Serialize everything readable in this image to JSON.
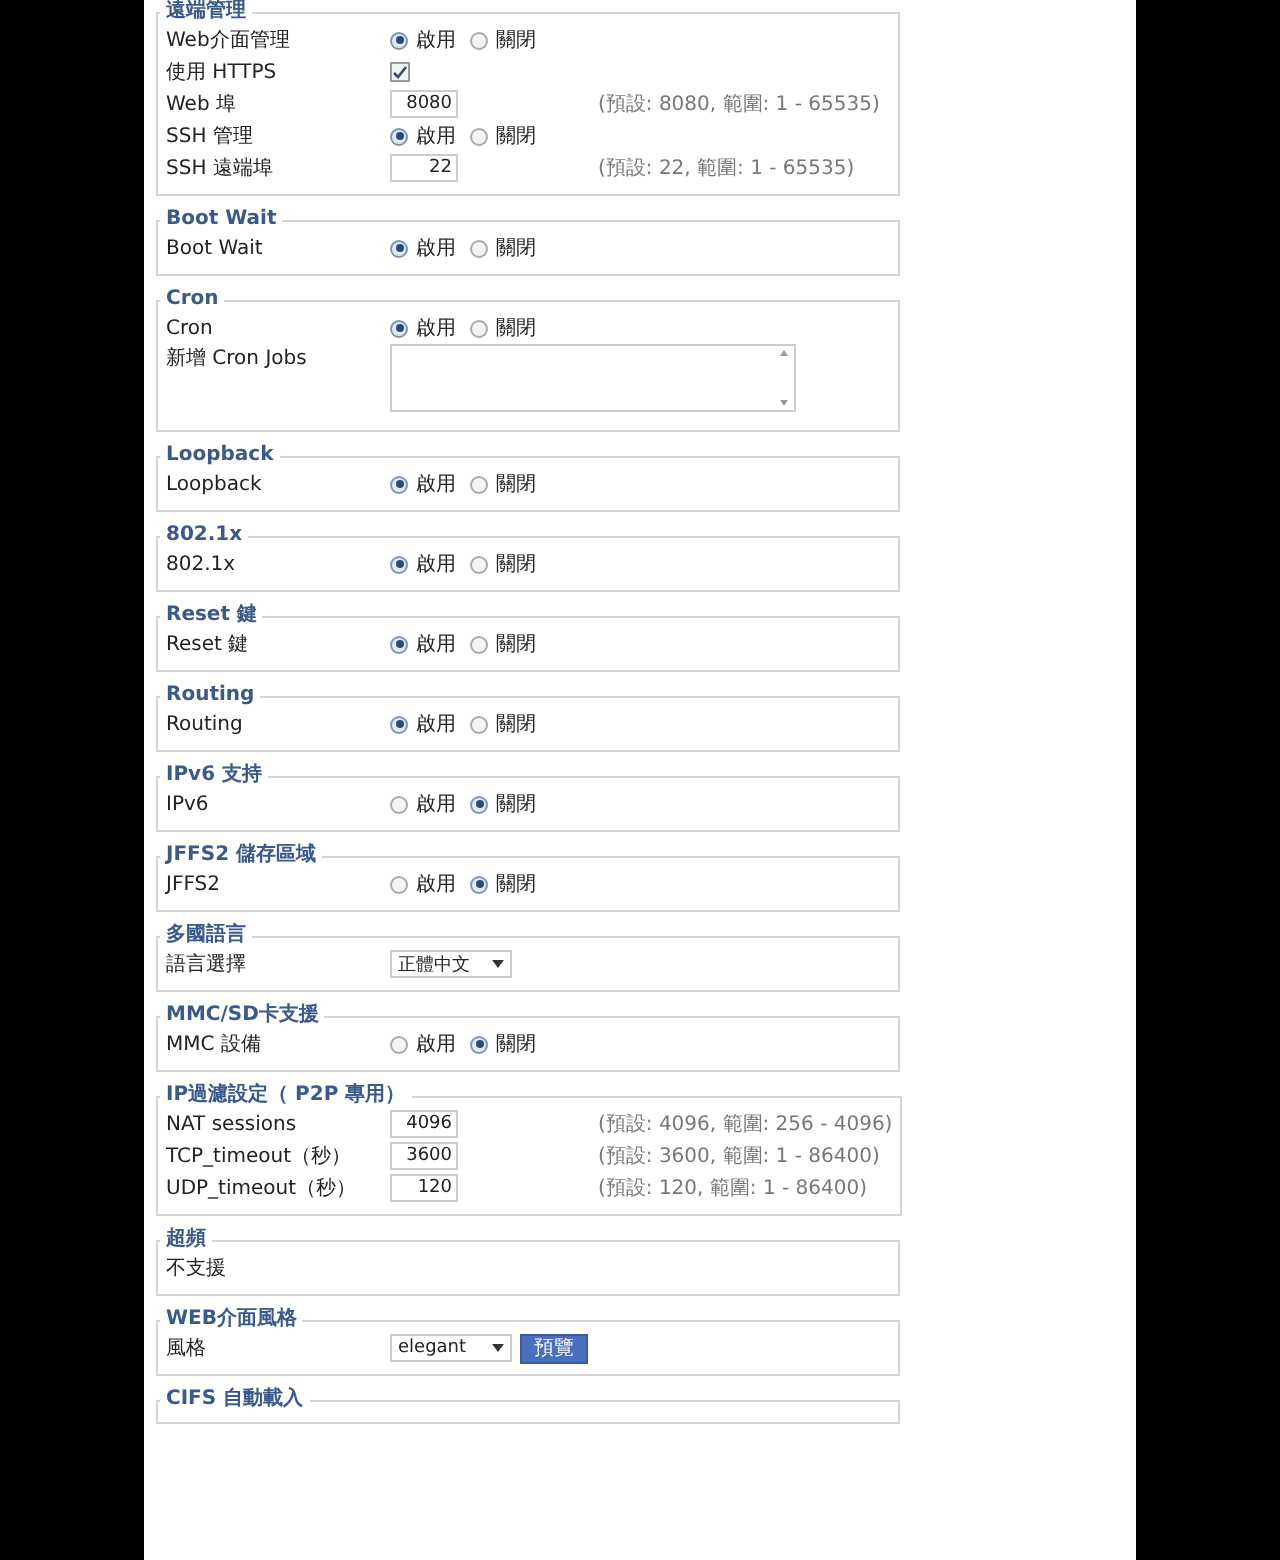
{
  "sections": [
    {
      "legend": "遠端管理",
      "rows": [
        {
          "kind": "radio",
          "label": "Web介面管理",
          "options": [
            {
              "label": "啟用",
              "selected": true
            },
            {
              "label": "關閉",
              "selected": false
            }
          ]
        },
        {
          "kind": "checkbox",
          "label": "使用 HTTPS",
          "checked": true
        },
        {
          "kind": "number",
          "label": "Web 埠",
          "value": "8080",
          "hint": "(預設: 8080, 範圍: 1 - 65535)"
        },
        {
          "kind": "radio",
          "label": "SSH 管理",
          "options": [
            {
              "label": "啟用",
              "selected": true
            },
            {
              "label": "關閉",
              "selected": false
            }
          ]
        },
        {
          "kind": "number",
          "label": "SSH 遠端埠",
          "value": "22",
          "hint": "(預設: 22, 範圍: 1 - 65535)"
        }
      ]
    },
    {
      "legend": "Boot Wait",
      "rows": [
        {
          "kind": "radio",
          "label": "Boot Wait",
          "options": [
            {
              "label": "啟用",
              "selected": true
            },
            {
              "label": "關閉",
              "selected": false
            }
          ]
        }
      ]
    },
    {
      "legend": "Cron",
      "rows": [
        {
          "kind": "radio",
          "label": "Cron",
          "options": [
            {
              "label": "啟用",
              "selected": true
            },
            {
              "label": "關閉",
              "selected": false
            }
          ]
        },
        {
          "kind": "textarea",
          "label": "新增 Cron Jobs"
        }
      ]
    },
    {
      "legend": "Loopback",
      "rows": [
        {
          "kind": "radio",
          "label": "Loopback",
          "options": [
            {
              "label": "啟用",
              "selected": true
            },
            {
              "label": "關閉",
              "selected": false
            }
          ]
        }
      ]
    },
    {
      "legend": "802.1x",
      "rows": [
        {
          "kind": "radio",
          "label": "802.1x",
          "options": [
            {
              "label": "啟用",
              "selected": true
            },
            {
              "label": "關閉",
              "selected": false
            }
          ]
        }
      ]
    },
    {
      "legend": "Reset 鍵",
      "rows": [
        {
          "kind": "radio",
          "label": "Reset 鍵",
          "options": [
            {
              "label": "啟用",
              "selected": true
            },
            {
              "label": "關閉",
              "selected": false
            }
          ]
        }
      ]
    },
    {
      "legend": "Routing",
      "rows": [
        {
          "kind": "radio",
          "label": "Routing",
          "options": [
            {
              "label": "啟用",
              "selected": true
            },
            {
              "label": "關閉",
              "selected": false
            }
          ]
        }
      ]
    },
    {
      "legend": "IPv6 支持",
      "rows": [
        {
          "kind": "radio",
          "label": "IPv6",
          "options": [
            {
              "label": "啟用",
              "selected": false
            },
            {
              "label": "關閉",
              "selected": true
            }
          ]
        }
      ]
    },
    {
      "legend": "JFFS2 儲存區域",
      "rows": [
        {
          "kind": "radio",
          "label": "JFFS2",
          "options": [
            {
              "label": "啟用",
              "selected": false
            },
            {
              "label": "關閉",
              "selected": true
            }
          ]
        }
      ]
    },
    {
      "legend": "多國語言",
      "rows": [
        {
          "kind": "select",
          "label": "語言選擇",
          "value": "正體中文"
        }
      ]
    },
    {
      "legend": "MMC/SD卡支援",
      "rows": [
        {
          "kind": "radio",
          "label": "MMC 設備",
          "options": [
            {
              "label": "啟用",
              "selected": false
            },
            {
              "label": "關閉",
              "selected": true
            }
          ]
        }
      ]
    },
    {
      "legend": "IP過濾設定（ P2P 專用）",
      "rows": [
        {
          "kind": "number",
          "label": "NAT sessions",
          "value": "4096",
          "hint": "(預設: 4096, 範圍: 256 - 4096)"
        },
        {
          "kind": "number",
          "label": "TCP_timeout（秒）",
          "value": "3600",
          "hint": "(預設: 3600, 範圍: 1 - 86400)"
        },
        {
          "kind": "number",
          "label": "UDP_timeout（秒）",
          "value": "120",
          "hint": "(預設: 120, 範圍: 1 - 86400)"
        }
      ]
    },
    {
      "legend": "超頻",
      "rows": [
        {
          "kind": "text",
          "label": "不支援"
        }
      ]
    },
    {
      "legend": "WEB介面風格",
      "rows": [
        {
          "kind": "select_button",
          "label": "風格",
          "value": "elegant",
          "button": "預覽"
        }
      ]
    },
    {
      "legend": "CIFS 自動載入"
    }
  ]
}
